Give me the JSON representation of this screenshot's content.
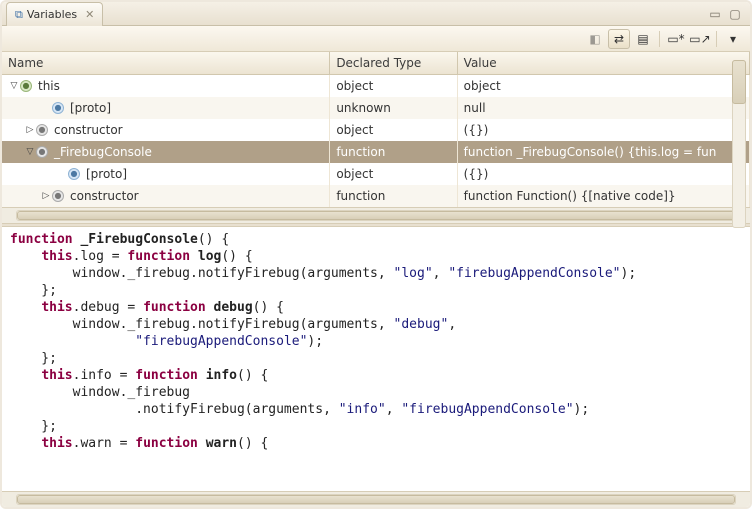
{
  "tab": {
    "title": "Variables",
    "icon": "⧉"
  },
  "window_buttons": {
    "minimize": "▭",
    "maximize": "▢"
  },
  "toolbar": {
    "btn1": {
      "name": "show-type-names",
      "glyph": "◧",
      "disabled": true
    },
    "btn2": {
      "name": "show-logical-structure",
      "glyph": "⇄",
      "selected": true
    },
    "btn3": {
      "name": "collapse-all",
      "glyph": "▤"
    },
    "btn4": {
      "name": "new-detail-pane",
      "glyph": "▭*"
    },
    "btn5": {
      "name": "open-new-view",
      "glyph": "▭↗"
    },
    "btn6": {
      "name": "view-menu",
      "glyph": "▾"
    }
  },
  "columns": {
    "name": "Name",
    "type": "Declared Type",
    "value": "Value"
  },
  "rows": [
    {
      "indent": 0,
      "twist": "▽",
      "iconClass": "vobj",
      "name": "this",
      "type": "object",
      "value": "object"
    },
    {
      "indent": 2,
      "twist": "",
      "iconClass": "vproto",
      "name": "[proto]",
      "type": "unknown",
      "value": "null"
    },
    {
      "indent": 1,
      "twist": "▷",
      "iconClass": "vfield",
      "name": "constructor",
      "type": "object",
      "value": "({})"
    },
    {
      "indent": 1,
      "twist": "▽",
      "iconClass": "vfield",
      "name": "_FirebugConsole",
      "type": "function",
      "value": "function _FirebugConsole() {this.log = fun",
      "selected": true
    },
    {
      "indent": 3,
      "twist": "",
      "iconClass": "vproto",
      "name": "[proto]",
      "type": "object",
      "value": "({})"
    },
    {
      "indent": 2,
      "twist": "▷",
      "iconClass": "vfield",
      "name": "constructor",
      "type": "function",
      "value": "function Function() {[native code]}"
    }
  ],
  "code": {
    "lines": [
      {
        "segments": [
          {
            "t": "kw",
            "v": "function"
          },
          {
            "t": "",
            "v": " "
          },
          {
            "t": "fn",
            "v": "_FirebugConsole"
          },
          {
            "t": "",
            "v": "() {"
          }
        ]
      },
      {
        "segments": [
          {
            "t": "",
            "v": "    "
          },
          {
            "t": "kw",
            "v": "this"
          },
          {
            "t": "",
            "v": ".log = "
          },
          {
            "t": "kw",
            "v": "function"
          },
          {
            "t": "",
            "v": " "
          },
          {
            "t": "fn",
            "v": "log"
          },
          {
            "t": "",
            "v": "() {"
          }
        ]
      },
      {
        "segments": [
          {
            "t": "",
            "v": "        window._firebug.notifyFirebug(arguments, "
          },
          {
            "t": "str",
            "v": "\"log\""
          },
          {
            "t": "",
            "v": ", "
          },
          {
            "t": "str",
            "v": "\"firebugAppendConsole\""
          },
          {
            "t": "",
            "v": ");"
          }
        ]
      },
      {
        "segments": [
          {
            "t": "",
            "v": "    };"
          }
        ]
      },
      {
        "segments": [
          {
            "t": "",
            "v": "    "
          },
          {
            "t": "kw",
            "v": "this"
          },
          {
            "t": "",
            "v": ".debug = "
          },
          {
            "t": "kw",
            "v": "function"
          },
          {
            "t": "",
            "v": " "
          },
          {
            "t": "fn",
            "v": "debug"
          },
          {
            "t": "",
            "v": "() {"
          }
        ]
      },
      {
        "segments": [
          {
            "t": "",
            "v": "        window._firebug.notifyFirebug(arguments, "
          },
          {
            "t": "str",
            "v": "\"debug\""
          },
          {
            "t": "",
            "v": ","
          }
        ]
      },
      {
        "segments": [
          {
            "t": "",
            "v": "                "
          },
          {
            "t": "str",
            "v": "\"firebugAppendConsole\""
          },
          {
            "t": "",
            "v": ");"
          }
        ]
      },
      {
        "segments": [
          {
            "t": "",
            "v": "    };"
          }
        ]
      },
      {
        "segments": [
          {
            "t": "",
            "v": "    "
          },
          {
            "t": "kw",
            "v": "this"
          },
          {
            "t": "",
            "v": ".info = "
          },
          {
            "t": "kw",
            "v": "function"
          },
          {
            "t": "",
            "v": " "
          },
          {
            "t": "fn",
            "v": "info"
          },
          {
            "t": "",
            "v": "() {"
          }
        ]
      },
      {
        "segments": [
          {
            "t": "",
            "v": "        window._firebug"
          }
        ]
      },
      {
        "segments": [
          {
            "t": "",
            "v": "                .notifyFirebug(arguments, "
          },
          {
            "t": "str",
            "v": "\"info\""
          },
          {
            "t": "",
            "v": ", "
          },
          {
            "t": "str",
            "v": "\"firebugAppendConsole\""
          },
          {
            "t": "",
            "v": ");"
          }
        ]
      },
      {
        "segments": [
          {
            "t": "",
            "v": "    };"
          }
        ]
      },
      {
        "segments": [
          {
            "t": "",
            "v": "    "
          },
          {
            "t": "kw",
            "v": "this"
          },
          {
            "t": "",
            "v": ".warn = "
          },
          {
            "t": "kw",
            "v": "function"
          },
          {
            "t": "",
            "v": " "
          },
          {
            "t": "fn",
            "v": "warn"
          },
          {
            "t": "",
            "v": "() {"
          }
        ]
      }
    ]
  }
}
